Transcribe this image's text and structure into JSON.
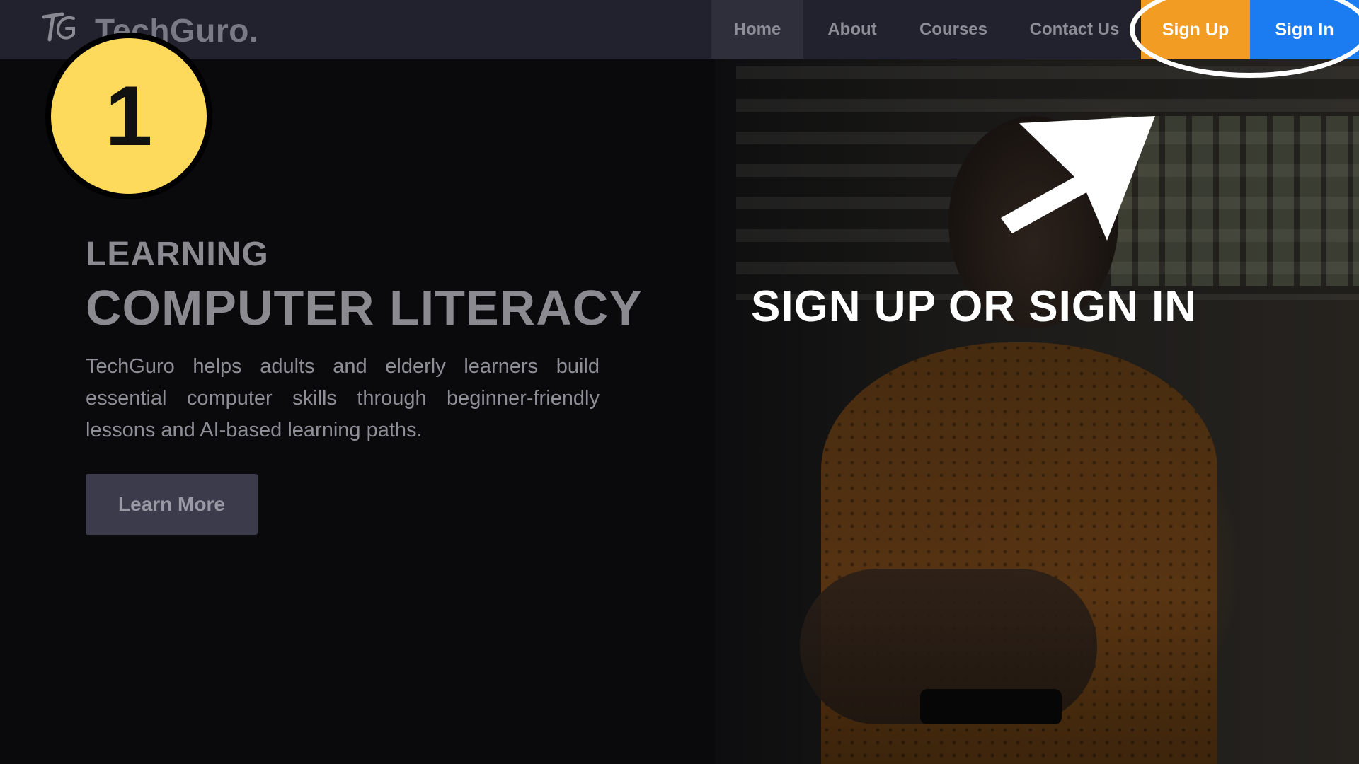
{
  "brand": {
    "name": "TechGuro.",
    "logo_icon": "tg-logo-icon"
  },
  "nav": {
    "items": [
      {
        "label": "Home",
        "active": true
      },
      {
        "label": "About"
      },
      {
        "label": "Courses"
      },
      {
        "label": "Contact Us"
      }
    ],
    "sign_up_label": "Sign Up",
    "sign_in_label": "Sign In"
  },
  "hero": {
    "kicker": "LEARNING",
    "title": "COMPUTER LITERACY",
    "description": "TechGuro helps adults and elderly learners build essential computer skills through beginner-friendly lessons and AI-based learning paths.",
    "cta_label": "Learn More"
  },
  "annotation": {
    "step_number": "1",
    "instruction": "SIGN UP OR SIGN IN",
    "arrow_icon": "arrow-up-right-icon"
  },
  "colors": {
    "navbar_bg": "#22222e",
    "sign_up": "#f39c24",
    "sign_in": "#1a7cf0",
    "badge": "#fdd95c",
    "cta_bg": "#3b3b4c"
  }
}
